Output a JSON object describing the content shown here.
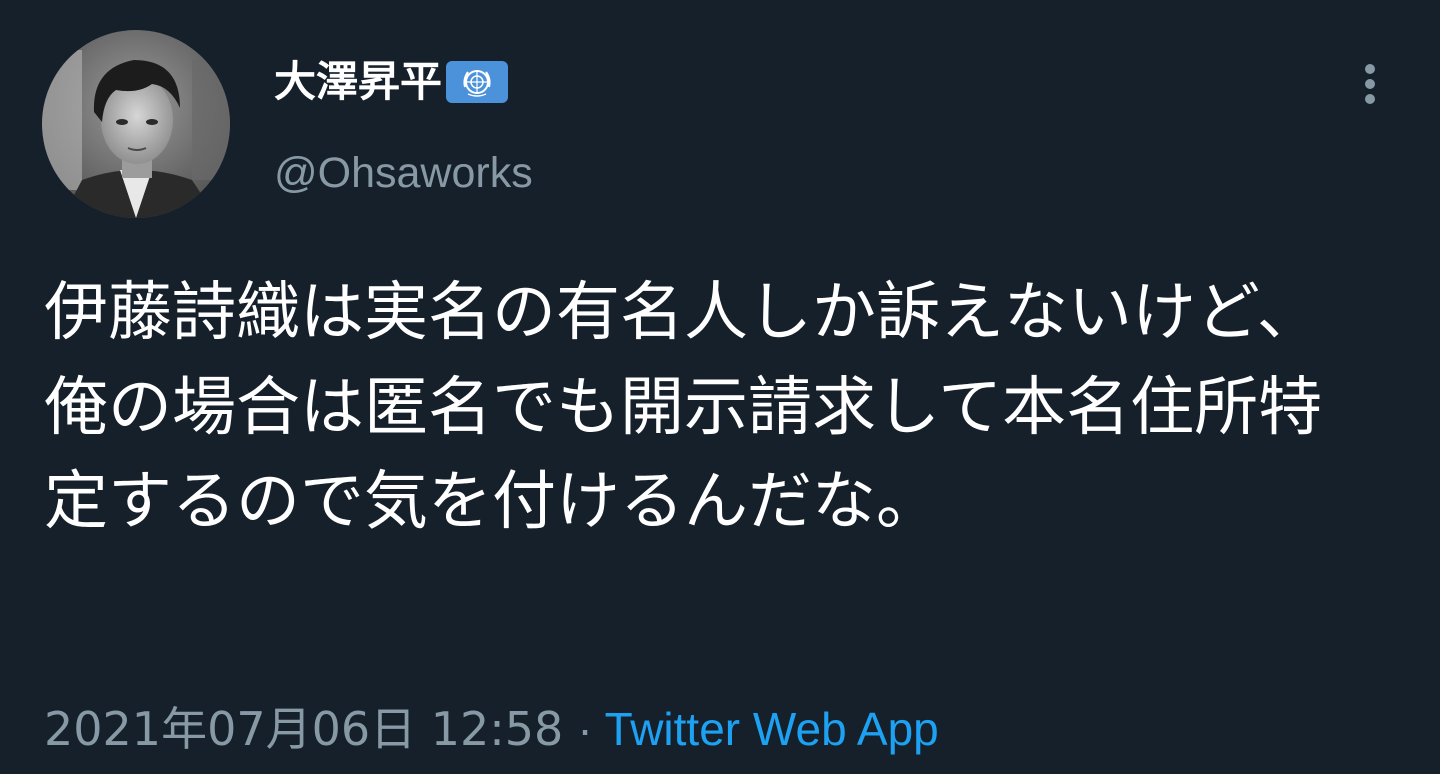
{
  "colors": {
    "background": "#15202b",
    "primary_text": "#ffffff",
    "secondary_text": "#8899a6",
    "link": "#1da1f2",
    "badge_blue": "#4b92db"
  },
  "author": {
    "display_name": "大澤昇平",
    "handle": "@Ohsaworks",
    "badge_icon": "un-emblem-icon",
    "avatar_icon": "profile-photo"
  },
  "menu": {
    "icon": "more-vertical-icon"
  },
  "tweet": {
    "text": "伊藤詩織は実名の有名人しか訴えないけど、俺の場合は匿名でも開示請求して本名住所特定するので気を付けるんだな。"
  },
  "meta": {
    "timestamp": "2021年07月06日 12:58",
    "separator": "·",
    "source": "Twitter Web App"
  }
}
